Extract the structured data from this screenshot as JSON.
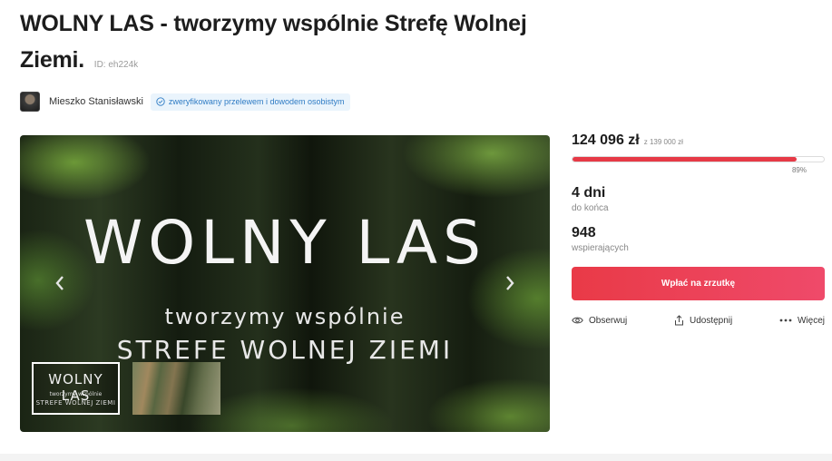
{
  "campaign": {
    "title": "WOLNY LAS - tworzymy wspólnie Strefę Wolnej Ziemi.",
    "id_label": "ID: eh224k"
  },
  "author": {
    "name": "Mieszko Stanisławski",
    "verified_text": "zweryfikowany przelewem i dowodem osobistym"
  },
  "hero": {
    "line1": "WOLNY LAS",
    "line2": "tworzymy wspólnie",
    "line3": "STREFE WOLNEJ ZIEMI"
  },
  "thumbnails": [
    {
      "line1": "WOLNY LAS",
      "line2": "tworzymy wspólnie",
      "line3": "STREFE WOLNEJ ZIEMI",
      "selected": true
    },
    {
      "selected": false
    }
  ],
  "funding": {
    "amount": "124 096 zł",
    "goal": "z 139 000 zł",
    "progress": 0.89,
    "percent_label": "89%"
  },
  "stats": {
    "days_value": "4 dni",
    "days_label": "do końca",
    "supporters_value": "948",
    "supporters_label": "wspierających"
  },
  "actions": {
    "pay_label": "Wpłać na zrzutkę",
    "follow_label": "Obserwuj",
    "share_label": "Udostępnij",
    "more_label": "Więcej"
  },
  "colors": {
    "accent": "#e63946",
    "verified_text": "#2e7bc4",
    "verified_bg": "#eaf4fc"
  },
  "icons": [
    "verified-check-icon",
    "chevron-left-icon",
    "chevron-right-icon",
    "eye-icon",
    "share-icon",
    "more-dots-icon"
  ]
}
